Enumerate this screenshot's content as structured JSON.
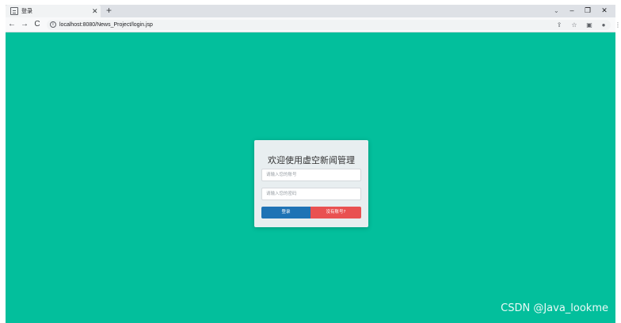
{
  "browser": {
    "tab": {
      "title": "登录",
      "favicon": "page-icon"
    },
    "new_tab_label": "+",
    "tab_search_icon": "chevron-down-icon",
    "window_buttons": {
      "minimize": "–",
      "maximize": "❐",
      "close": "✕"
    },
    "nav": {
      "back": "←",
      "forward": "→",
      "reload": "C"
    },
    "url": "localhost:8080/News_Project/login.jsp",
    "toolbar_icons": [
      "share-icon",
      "star-icon",
      "side-panel-icon",
      "profile-icon",
      "menu-icon"
    ]
  },
  "page": {
    "background_color": "#03bf9c",
    "login": {
      "title": "欢迎使用虚空新闻管理",
      "account_placeholder": "请输入您的账号",
      "password_placeholder": "请输入您的密码",
      "login_button": "登录",
      "register_button": "没有账号?"
    },
    "colors": {
      "login_button": "#1e73b5",
      "register_button": "#e95151"
    }
  },
  "watermark": "CSDN @Java_lookme"
}
